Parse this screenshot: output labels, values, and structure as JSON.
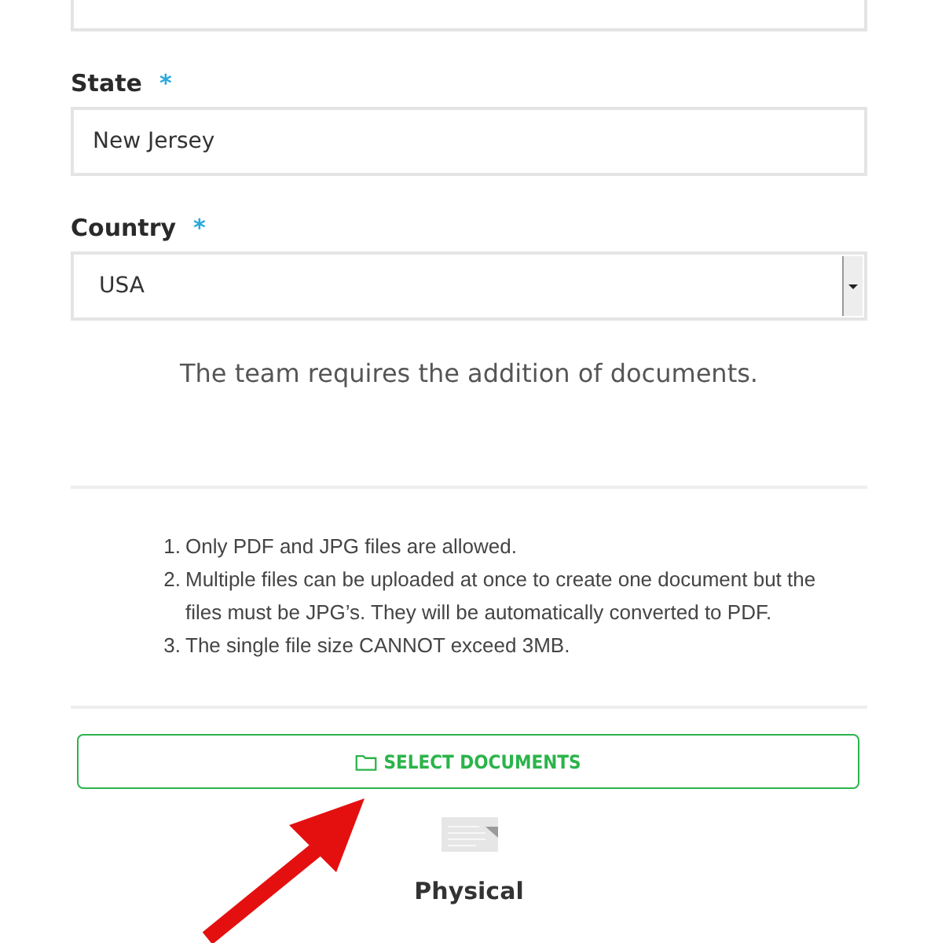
{
  "fields": [
    {
      "kind": "text",
      "label": "State",
      "required_mark": "*",
      "value": "New Jersey"
    },
    {
      "kind": "select",
      "label": "Country",
      "required_mark": "*",
      "value": "USA"
    }
  ],
  "notice": "The team requires the addition of documents.",
  "rules": [
    {
      "number": "1.",
      "text": "Only PDF and JPG files are allowed."
    },
    {
      "number": "2.",
      "text": "Multiple files can be uploaded at once to create one document but the files must be JPG’s. They will be automatically converted to PDF."
    },
    {
      "number": "3.",
      "text": "The single file size CANNOT exceed 3MB."
    }
  ],
  "select_button": "SELECT DOCUMENTS",
  "document_type": "Physical"
}
